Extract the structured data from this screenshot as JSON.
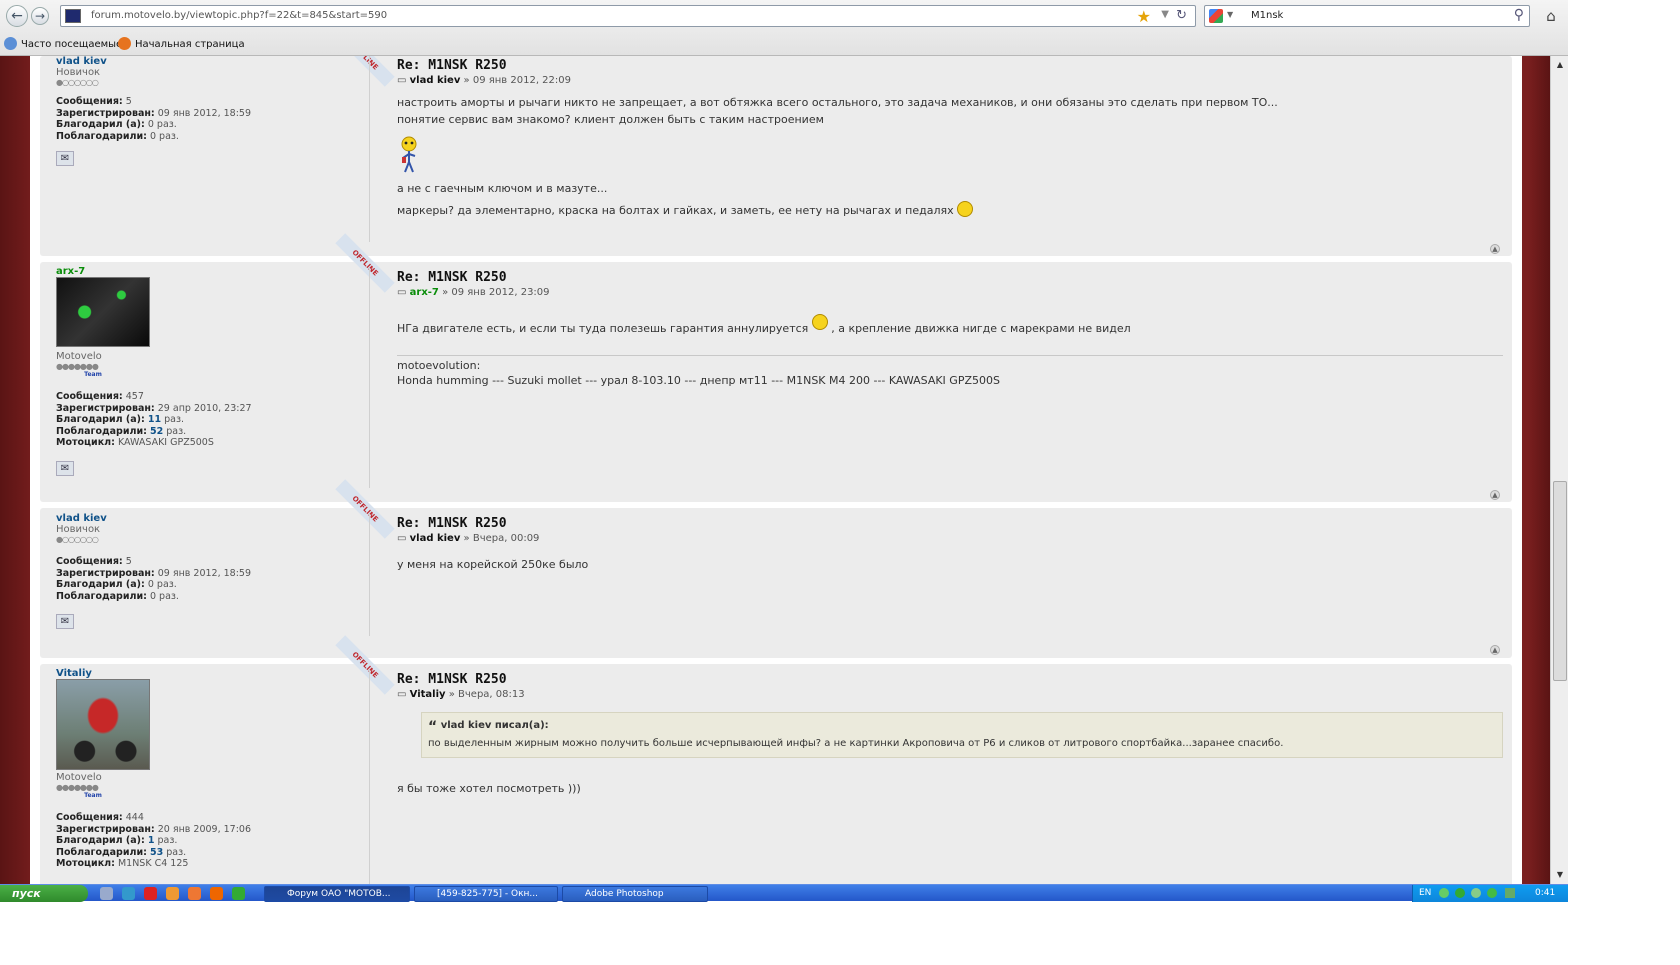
{
  "browser": {
    "url": "forum.motovelo.by/viewtopic.php?f=22&t=845&start=590",
    "search_value": "M1nsk",
    "bookmarks": [
      "Часто посещаемые",
      "Начальная страница"
    ]
  },
  "posts": [
    {
      "author": "vlad kiev",
      "rank": "Новичок",
      "badge": "OFFLINE",
      "stats": {
        "posts_label": "Сообщения:",
        "posts": "5",
        "registered_label": "Зарегистрирован:",
        "registered": "09 янв 2012, 18:59",
        "thanked_label": "Благодарил (а):",
        "thanked": "0 раз.",
        "was_thanked_label": "Поблагодарили:",
        "was_thanked": "0 раз."
      },
      "title": "Re: M1NSK R250",
      "date": "» 09 янв 2012, 22:09",
      "text1": "настроить аморты и рычаги никто не запрещает, а вот обтяжка всего остального, это задача механиков, и они обязаны это сделать при первом ТО...",
      "text2": "понятие сервис вам знакомо? клиент должен быть с таким настроением",
      "text3": "а не с гаечным ключом и в мазуте...",
      "text4": "маркеры? да элементарно, краска на болтах и гайках, и заметь, ее нету на рычагах и педалях"
    },
    {
      "author": "arx-7",
      "rank": "Motovelo",
      "badge": "OFFLINE",
      "team": "Team",
      "stats": {
        "posts_label": "Сообщения:",
        "posts": "457",
        "registered_label": "Зарегистрирован:",
        "registered": "29 апр 2010, 23:27",
        "thanked_label": "Благодарил (а):",
        "thanked_num": "11",
        "thanked_suffix": "раз.",
        "was_thanked_label": "Поблагодарили:",
        "was_thanked_num": "52",
        "was_thanked_suffix": "раз.",
        "moto_label": "Мотоцикл:",
        "moto": "KAWASAKI GPZ500S"
      },
      "title": "Re: M1NSK R250",
      "date": "» 09 янв 2012, 23:09",
      "text_before": "НГа двигателе есть, и если ты туда полезешь гарантия аннулируется",
      "text_after": ", а крепление движка нигде с марекрами не видел",
      "sig1": "motoevolution:",
      "sig2": "Honda humming --- Suzuki mollet --- урал 8-103.10 --- днепр мт11 --- M1NSK M4 200 --- KAWASAKI GPZ500S"
    },
    {
      "author": "vlad kiev",
      "rank": "Новичок",
      "badge": "OFFLINE",
      "stats": {
        "posts_label": "Сообщения:",
        "posts": "5",
        "registered_label": "Зарегистрирован:",
        "registered": "09 янв 2012, 18:59",
        "thanked_label": "Благодарил (а):",
        "thanked": "0 раз.",
        "was_thanked_label": "Поблагодарили:",
        "was_thanked": "0 раз."
      },
      "title": "Re: M1NSK R250",
      "date": "» Вчера, 00:09",
      "text1": "у меня на корейской 250ке было"
    },
    {
      "author": "Vitaliy",
      "rank": "Motovelo",
      "badge": "OFFLINE",
      "team": "Team",
      "stats": {
        "posts_label": "Сообщения:",
        "posts": "444",
        "registered_label": "Зарегистрирован:",
        "registered": "20 янв 2009, 17:06",
        "thanked_label": "Благодарил (а):",
        "thanked_num": "1",
        "thanked_suffix": "раз.",
        "was_thanked_label": "Поблагодарили:",
        "was_thanked_num": "53",
        "was_thanked_suffix": "раз.",
        "moto_label": "Мотоцикл:",
        "moto": "M1NSK C4 125"
      },
      "title": "Re: M1NSK R250",
      "date": "» Вчера, 08:13",
      "quote_author": "vlad kiev писал(а):",
      "quote_text": "по выделенным жирным можно получить больше исчерпывающей инфы? а не картинки Акроповича от Р6 и сликов от литрового спортбайка...заранее спасибо.",
      "text1": "я бы тоже хотел посмотреть )))"
    }
  ],
  "taskbar": {
    "start": "пуск",
    "tasks": [
      "Форум ОАО \"МОТОВ...",
      "[459-825-775] - Окн...",
      "Adobe Photoshop"
    ],
    "lang": "EN",
    "clock": "0:41"
  }
}
